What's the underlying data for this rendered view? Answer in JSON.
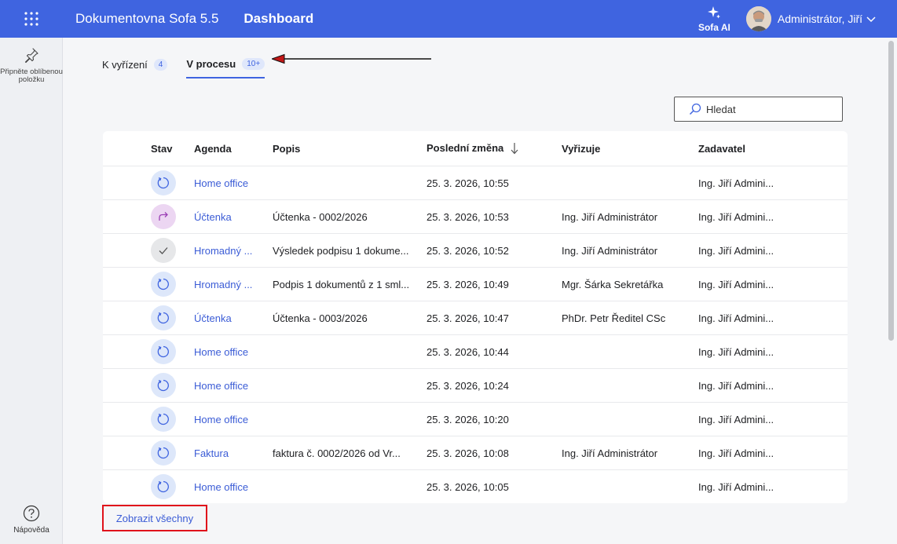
{
  "header": {
    "app_name": "Dokumentovna Sofa 5.5",
    "page_title": "Dashboard",
    "ai_label": "Sofa AI",
    "user_name": "Administrátor, Jiří",
    "accent": "#3f64e0"
  },
  "sidebar": {
    "pin_label": "Připněte oblíbenou položku",
    "help_label": "Nápověda"
  },
  "tabs": [
    {
      "label": "K vyřízení",
      "badge": "4",
      "active": false
    },
    {
      "label": "V procesu",
      "badge": "10+",
      "active": true
    }
  ],
  "search": {
    "placeholder": "Hledat"
  },
  "table": {
    "headers": {
      "stav": "Stav",
      "agenda": "Agenda",
      "popis": "Popis",
      "zmena": "Poslední změna",
      "vyrizuje": "Vyřizuje",
      "zadavatel": "Zadavatel"
    },
    "rows": [
      {
        "status": "progress",
        "agenda": "Home office",
        "popis": "",
        "zmena": "25. 3. 2026, 10:55",
        "vyrizuje": "",
        "zadavatel": "Ing. Jiří Admini..."
      },
      {
        "status": "forward",
        "agenda": "Účtenka",
        "popis": "Účtenka - 0002/2026",
        "zmena": "25. 3. 2026, 10:53",
        "vyrizuje": "Ing. Jiří Administrátor",
        "zadavatel": "Ing. Jiří Admini..."
      },
      {
        "status": "done",
        "agenda": "Hromadný ...",
        "popis": "Výsledek podpisu 1 dokume...",
        "zmena": "25. 3. 2026, 10:52",
        "vyrizuje": "Ing. Jiří Administrátor",
        "zadavatel": "Ing. Jiří Admini..."
      },
      {
        "status": "progress",
        "agenda": "Hromadný ...",
        "popis": "Podpis 1 dokumentů z 1 sml...",
        "zmena": "25. 3. 2026, 10:49",
        "vyrizuje": "Mgr. Šárka Sekretářka",
        "zadavatel": "Ing. Jiří Admini..."
      },
      {
        "status": "progress",
        "agenda": "Účtenka",
        "popis": "Účtenka - 0003/2026",
        "zmena": "25. 3. 2026, 10:47",
        "vyrizuje": "PhDr. Petr Ředitel CSc",
        "zadavatel": "Ing. Jiří Admini..."
      },
      {
        "status": "progress",
        "agenda": "Home office",
        "popis": "",
        "zmena": "25. 3. 2026, 10:44",
        "vyrizuje": "",
        "zadavatel": "Ing. Jiří Admini..."
      },
      {
        "status": "progress",
        "agenda": "Home office",
        "popis": "",
        "zmena": "25. 3. 2026, 10:24",
        "vyrizuje": "",
        "zadavatel": "Ing. Jiří Admini..."
      },
      {
        "status": "progress",
        "agenda": "Home office",
        "popis": "",
        "zmena": "25. 3. 2026, 10:20",
        "vyrizuje": "",
        "zadavatel": "Ing. Jiří Admini..."
      },
      {
        "status": "progress",
        "agenda": "Faktura",
        "popis": "faktura č. 0002/2026 od Vr...",
        "zmena": "25. 3. 2026, 10:08",
        "vyrizuje": "Ing. Jiří Administrátor",
        "zadavatel": "Ing. Jiří Admini..."
      },
      {
        "status": "progress",
        "agenda": "Home office",
        "popis": "",
        "zmena": "25. 3. 2026, 10:05",
        "vyrizuje": "",
        "zadavatel": "Ing. Jiří Admini..."
      }
    ]
  },
  "show_all_label": "Zobrazit všechny"
}
